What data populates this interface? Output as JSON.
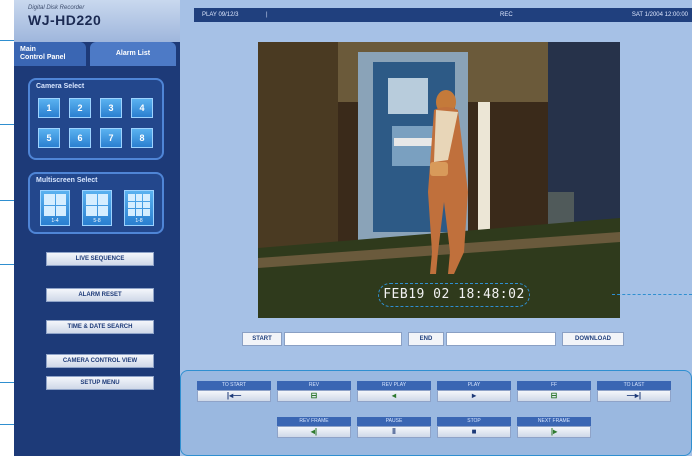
{
  "brand": {
    "subtitle": "Digital Disk Recorder",
    "model": "WJ-HD220"
  },
  "tabs": [
    {
      "label": "Main\nControl Panel"
    },
    {
      "label": "Alarm List"
    }
  ],
  "camera_select": {
    "title": "Camera Select",
    "buttons": [
      "1",
      "2",
      "3",
      "4",
      "5",
      "6",
      "7",
      "8"
    ]
  },
  "multiscreen_select": {
    "title": "Multiscreen Select",
    "buttons": [
      {
        "label": "1-4"
      },
      {
        "label": "5-8"
      },
      {
        "label": "1-8"
      }
    ]
  },
  "side_buttons": {
    "live_sequence": "LIVE SEQUENCE",
    "alarm_reset": "ALARM RESET",
    "time_date_search": "TIME & DATE SEARCH",
    "camera_control_view": "CAMERA CONTROL VIEW",
    "setup_menu": "SETUP MENU"
  },
  "status": {
    "play": "PLAY 09/12/3",
    "cursor": "|",
    "rec": "REC",
    "date": "SAT 1/2004 12:00:00"
  },
  "viewer": {
    "timestamp": "FEB19 02 18:48:02"
  },
  "search": {
    "start_label": "START",
    "end_label": "END",
    "download_label": "DOWNLOAD"
  },
  "controls": {
    "row1": [
      {
        "label": "TO START",
        "glyph": "|◂—"
      },
      {
        "label": "REV",
        "glyph": "⊟"
      },
      {
        "label": "REV PLAY",
        "glyph": "◂"
      },
      {
        "label": "PLAY",
        "glyph": "▸"
      },
      {
        "label": "FF",
        "glyph": "⊟"
      },
      {
        "label": "TO LAST",
        "glyph": "—▸|"
      }
    ],
    "row2": [
      {
        "label": "REV FRAME",
        "glyph": "◂|"
      },
      {
        "label": "PAUSE",
        "glyph": "‖"
      },
      {
        "label": "STOP",
        "glyph": "■"
      },
      {
        "label": "NEXT FRAME",
        "glyph": "|▸"
      }
    ]
  },
  "colors": {
    "sidebar": "#1d3a78",
    "main_bg": "#a6c1e6",
    "annotation": "#2f8fd0",
    "button_blue": "#2a7fd0"
  }
}
